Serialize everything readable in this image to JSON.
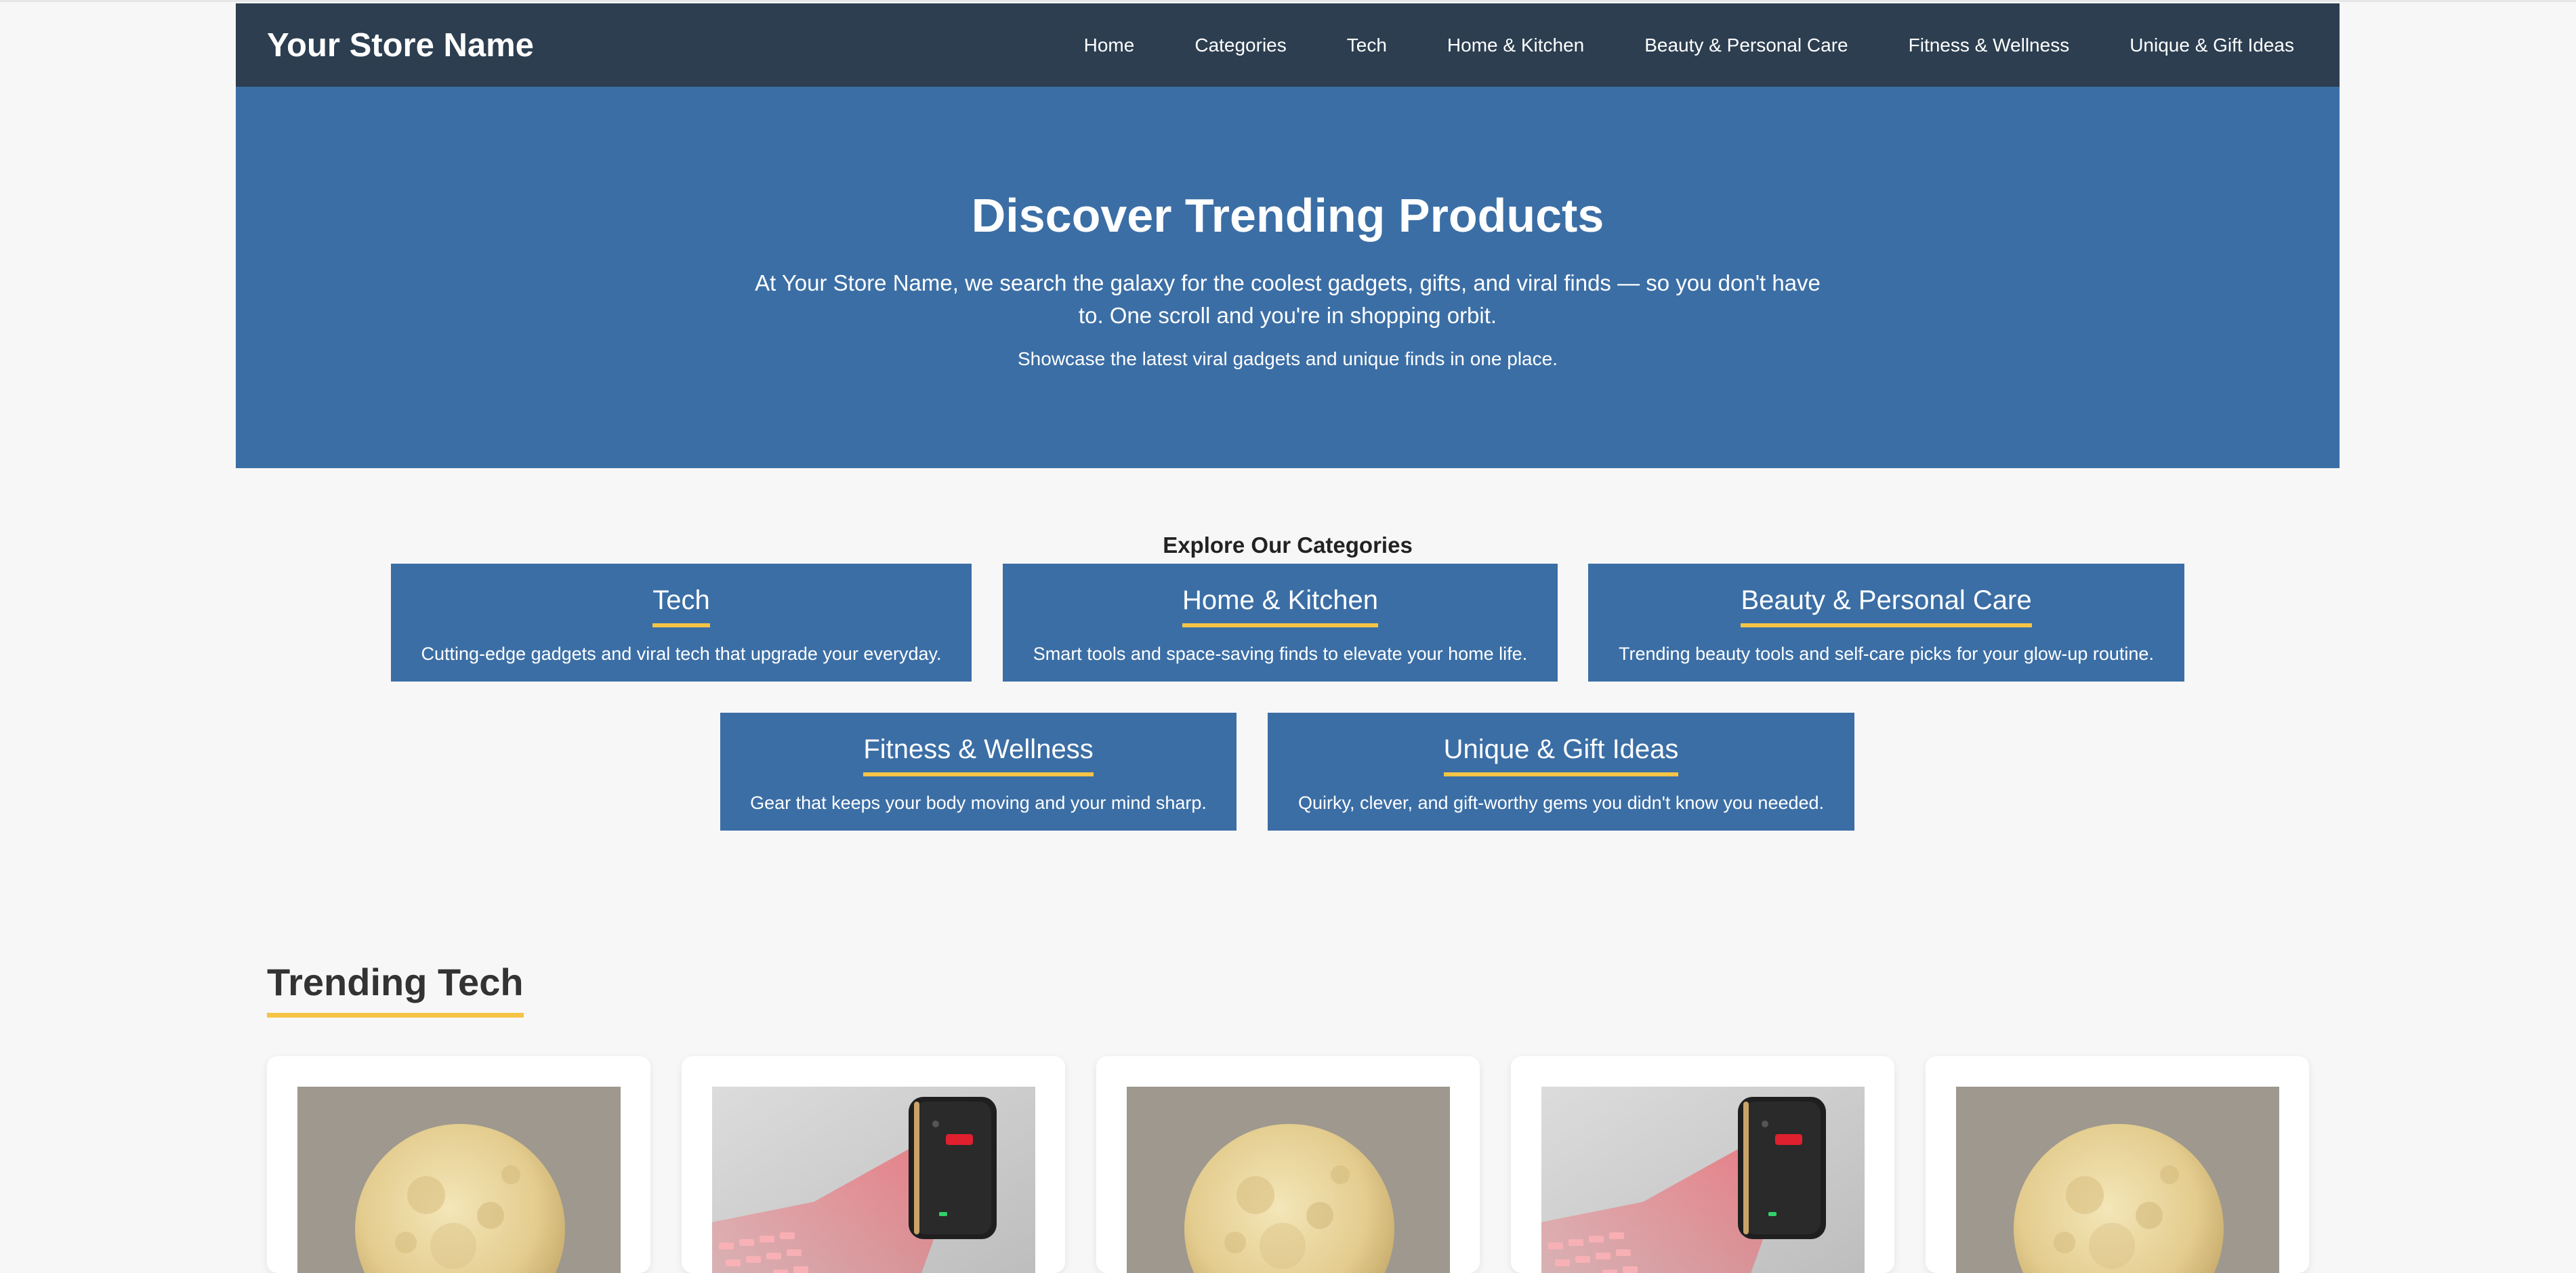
{
  "header": {
    "brand": "Your Store Name",
    "nav": [
      "Home",
      "Categories",
      "Tech",
      "Home & Kitchen",
      "Beauty & Personal Care",
      "Fitness & Wellness",
      "Unique & Gift Ideas"
    ]
  },
  "hero": {
    "title": "Discover Trending Products",
    "text": "At Your Store Name, we search the galaxy for the coolest gadgets, gifts, and viral finds — so you don't have to. One scroll and you're in shopping orbit.",
    "subtext": "Showcase the latest viral gadgets and unique finds in one place."
  },
  "categories": {
    "heading": "Explore Our Categories",
    "items": [
      {
        "title": "Tech",
        "desc": "Cutting-edge gadgets and viral tech that upgrade your everyday."
      },
      {
        "title": "Home & Kitchen",
        "desc": "Smart tools and space-saving finds to elevate your home life."
      },
      {
        "title": "Beauty & Personal Care",
        "desc": "Trending beauty tools and self-care picks for your glow-up routine."
      },
      {
        "title": "Fitness & Wellness",
        "desc": "Gear that keeps your body moving and your mind sharp."
      },
      {
        "title": "Unique & Gift Ideas",
        "desc": "Quirky, clever, and gift-worthy gems you didn't know you needed."
      }
    ]
  },
  "trending": {
    "title": "Trending Tech",
    "products": [
      {
        "image": "moon-lamp-image"
      },
      {
        "image": "laser-keyboard-image"
      },
      {
        "image": "moon-lamp-image"
      },
      {
        "image": "laser-keyboard-image"
      },
      {
        "image": "moon-lamp-image"
      }
    ]
  },
  "colors": {
    "navbar": "#2c3e50",
    "primary": "#3b6ea5",
    "accent": "#f6c445",
    "background": "#f7f7f7"
  }
}
